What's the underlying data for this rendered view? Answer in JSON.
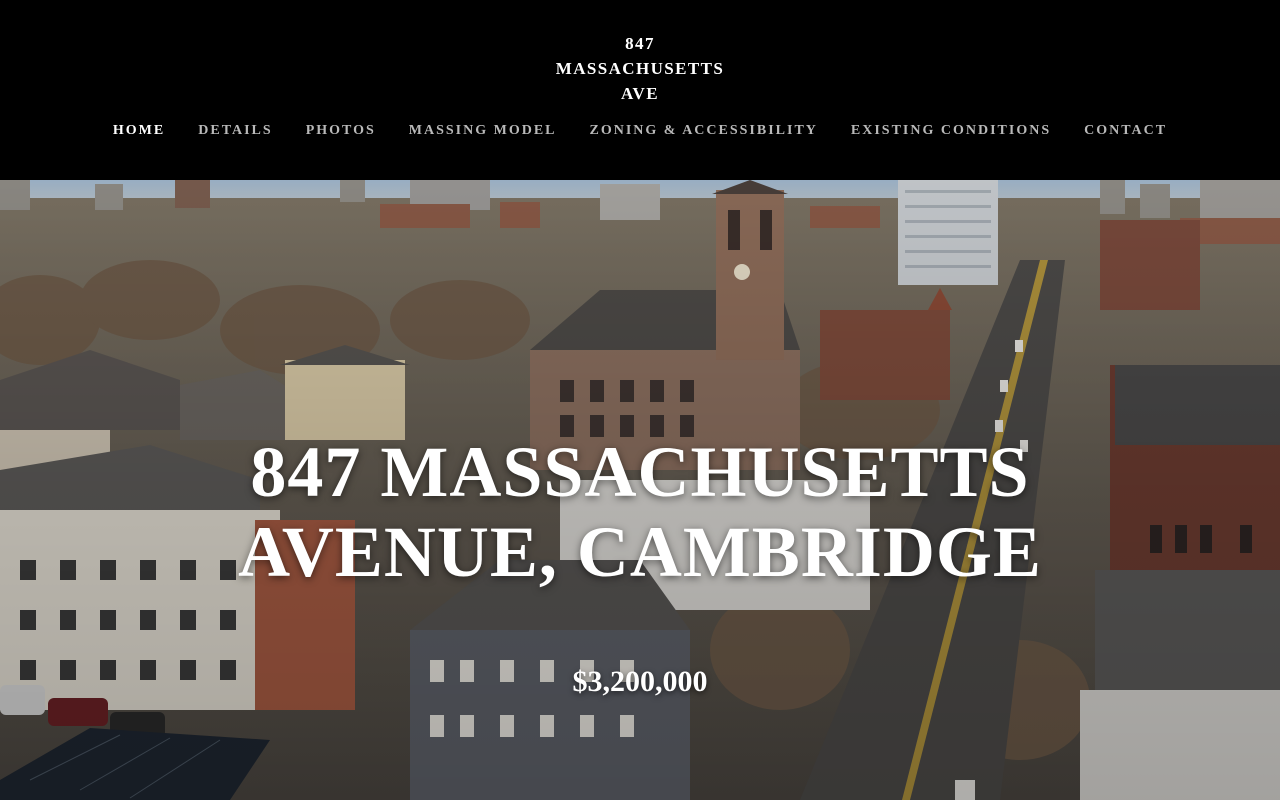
{
  "site": {
    "title_lines": [
      "847",
      "MASSACHUSETTS",
      "AVE"
    ]
  },
  "nav": {
    "items": [
      {
        "label": "HOME",
        "active": true
      },
      {
        "label": "DETAILS",
        "active": false
      },
      {
        "label": "PHOTOS",
        "active": false
      },
      {
        "label": "MASSING MODEL",
        "active": false
      },
      {
        "label": "ZONING & ACCESSIBILITY",
        "active": false
      },
      {
        "label": "EXISTING CONDITIONS",
        "active": false
      },
      {
        "label": "CONTACT",
        "active": false
      }
    ]
  },
  "hero": {
    "headline_lines": [
      "847 MASSACHUSETTS",
      "AVENUE, CAMBRIDGE"
    ],
    "price": "$3,200,000"
  },
  "colors": {
    "header_bg": "#000000",
    "nav_text": "#b9b9b9",
    "nav_active": "#ffffff",
    "hero_text": "#ffffff"
  }
}
